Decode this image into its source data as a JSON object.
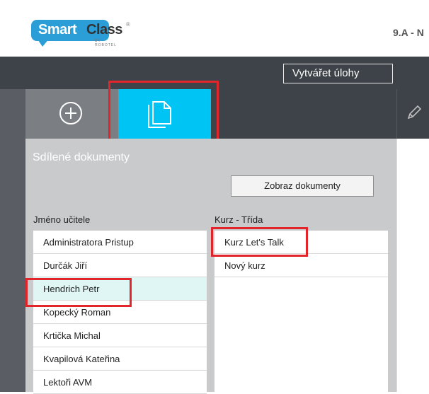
{
  "header": {
    "logo_smart": "Smart",
    "logo_class": "Class",
    "logo_tm": "®",
    "logo_sub": "BY ROBOTEL",
    "class_label": "9.A - N"
  },
  "toolbar": {
    "create_tasks_label": "Vytvářet úlohy"
  },
  "tools": {
    "add": {
      "icon": "plus-circle-icon"
    },
    "documents": {
      "icon": "documents-icon",
      "active": true
    },
    "edit": {
      "icon": "pencil-icon"
    }
  },
  "panel": {
    "title": "Sdílené dokumenty",
    "show_button": "Zobraz dokumenty",
    "teachers_header": "Jméno učitele",
    "courses_header": "Kurz - Třída",
    "teachers": [
      "Administratora Pristup",
      "Durčák Jiří",
      "Hendrich Petr",
      "Kopecký Roman",
      "Krtička Michal",
      "Kvapilová Kateřina",
      "Lektoři AVM"
    ],
    "selected_teacher_index": 2,
    "courses": [
      "Kurz Let's Talk",
      "Nový kurz"
    ]
  },
  "colors": {
    "accent": "#00c4f4",
    "dark_bar": "#3e4249",
    "panel_bg": "#c9cacc",
    "highlight": "#e2252b",
    "selected_row": "#dff6f4"
  }
}
